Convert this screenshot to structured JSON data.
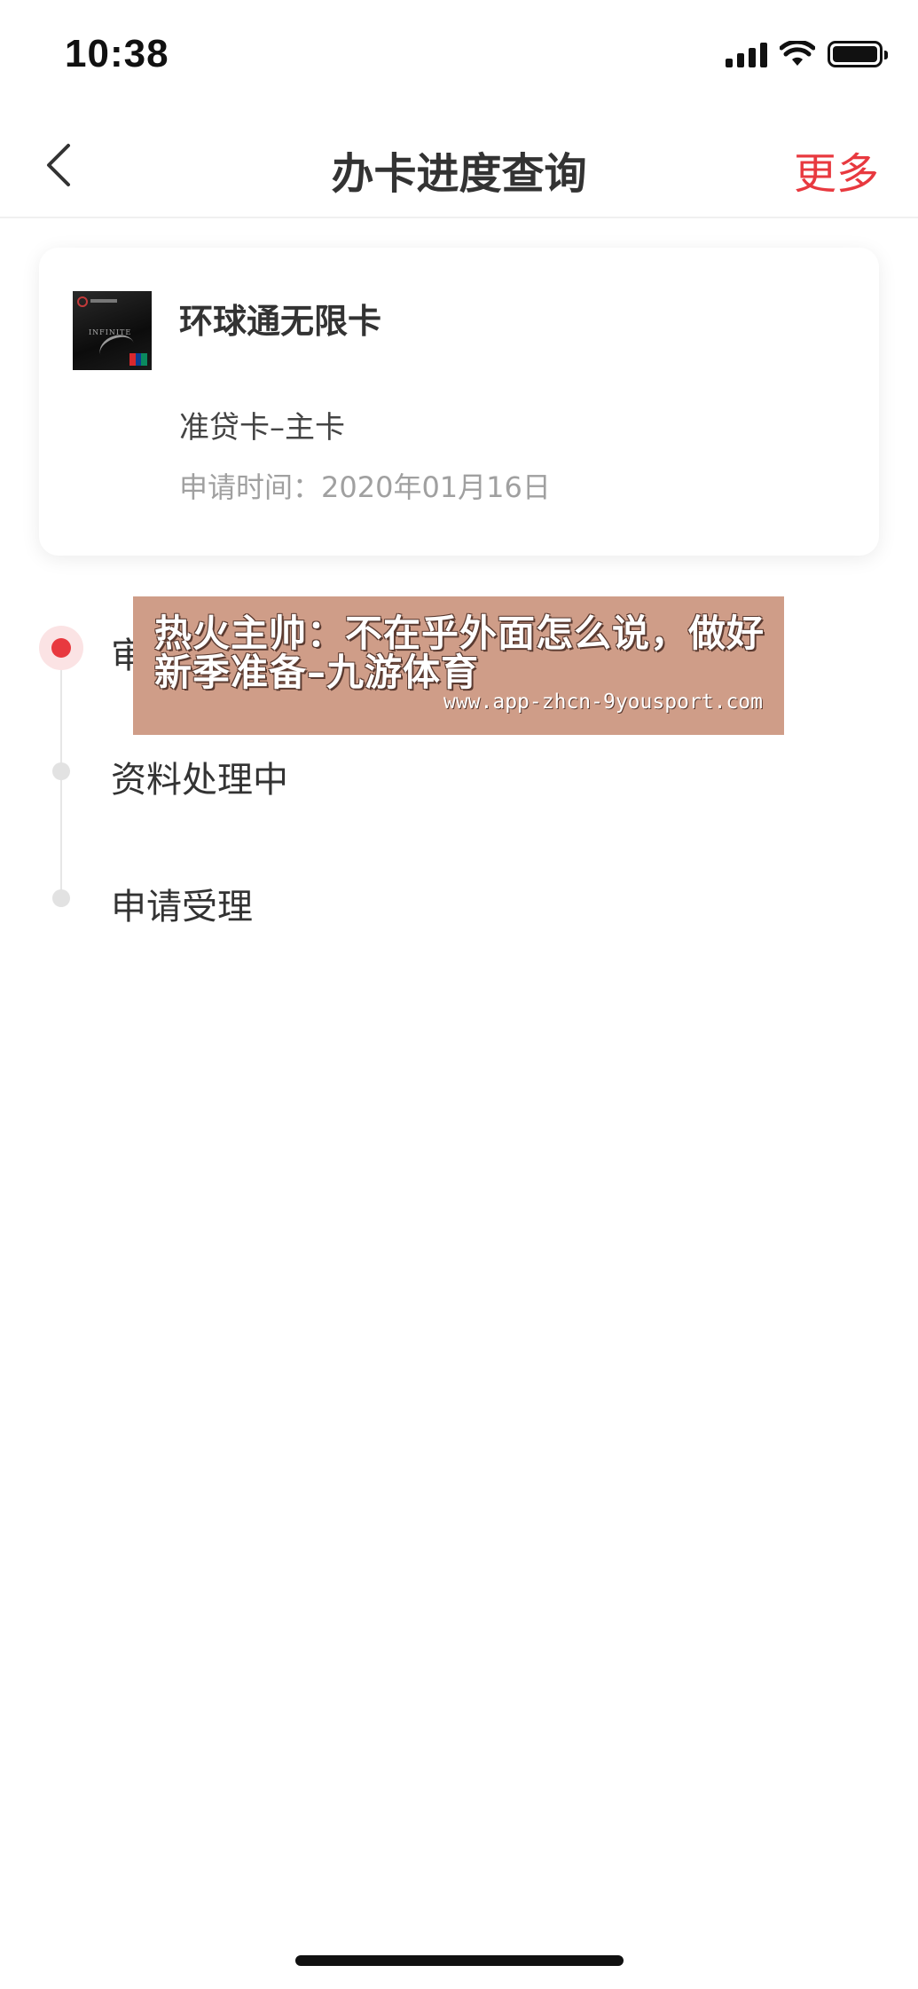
{
  "status_bar": {
    "time": "10:38",
    "icons": [
      "signal-icon",
      "wifi-icon",
      "battery-icon"
    ]
  },
  "nav": {
    "back_icon": "chevron-left-icon",
    "title": "办卡进度查询",
    "more_label": "更多"
  },
  "card": {
    "name": "环球通无限卡",
    "type": "准贷卡–主卡",
    "apply_date": "申请时间：2020年01月16日"
  },
  "timeline": {
    "steps": [
      {
        "label": "审批中",
        "status": "current"
      },
      {
        "label": "资料处理中",
        "status": "done"
      },
      {
        "label": "申请受理",
        "status": "done"
      }
    ]
  },
  "ad_overlay": {
    "title": "热火主帅：不在乎外面怎么说，做好新季准备–九游体育",
    "url": "www.app-zhcn-9yousport.com"
  },
  "colors": {
    "accent": "#e8393f",
    "text_primary": "#333333",
    "text_secondary": "#a0a0a0",
    "timeline_inactive": "#e2e2e2",
    "ad_background": "#cf9d88"
  }
}
